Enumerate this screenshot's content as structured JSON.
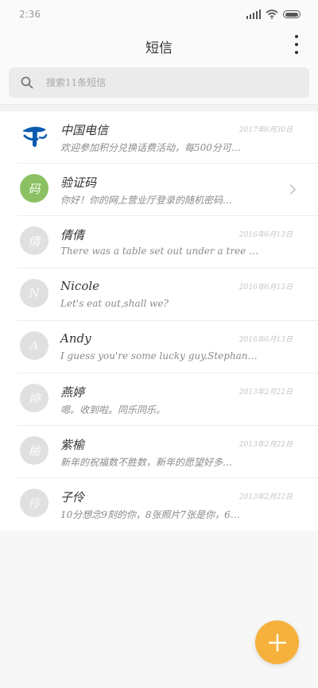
{
  "status_bar": {
    "time": "2:36",
    "icons": [
      "signal-icon",
      "wifi-icon",
      "battery-icon"
    ]
  },
  "header": {
    "title": "短信",
    "more_icon": "more-vertical-icon"
  },
  "search": {
    "placeholder": "搜索11条短信",
    "icon": "search-icon"
  },
  "conversations": [
    {
      "avatar_text": "",
      "avatar_icon": "china-telecom-logo",
      "name": "中国电信",
      "time": "2017年6月30日",
      "preview": "欢迎参加积分兑换话费活动，每500分可…"
    },
    {
      "avatar_text": "码",
      "name": "验证码",
      "time": "",
      "preview": "你好！你的网上营业厅登录的随机密码…",
      "has_chevron": true
    },
    {
      "avatar_text": "倩",
      "name": "倩倩",
      "time": "2016年6月13日",
      "preview": "There was a table set out under a tree in …"
    },
    {
      "avatar_text": "N",
      "name": "Nicole",
      "time": "2016年6月13日",
      "preview": "Let's eat out,shall we?"
    },
    {
      "avatar_text": "A",
      "name": "Andy",
      "time": "2016年6月13日",
      "preview": "I guess you're some lucky guy.Stephanie i…"
    },
    {
      "avatar_text": "婷",
      "name": "燕婷",
      "time": "2013年2月22日",
      "preview": "嗯。收到啦。同乐同乐。"
    },
    {
      "avatar_text": "榆",
      "name": "紫榆",
      "time": "2013年2月22日",
      "preview": "新年的祝福数不胜数，新年的愿望好多…"
    },
    {
      "avatar_text": "伶",
      "name": "子伶",
      "time": "2013年2月22日",
      "preview": "10分想念9刻的你，8张照片7张是你，6…"
    }
  ],
  "fab": {
    "icon": "plus-icon"
  },
  "colors": {
    "accent": "#f6b13c",
    "verification_avatar": "#8bc163",
    "telecom_blue": "#0a5bb0"
  }
}
